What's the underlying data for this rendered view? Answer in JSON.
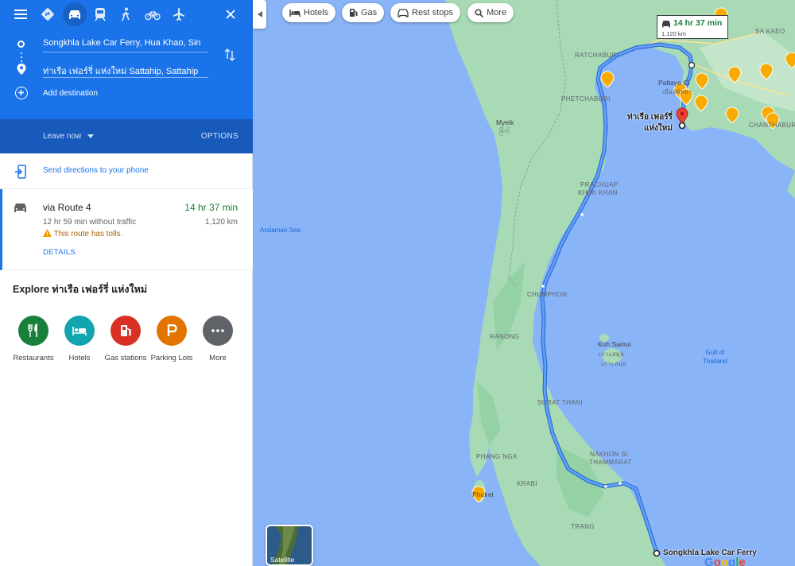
{
  "modes": [
    {
      "name": "menu-icon"
    },
    {
      "name": "best-route-icon"
    },
    {
      "name": "driving-icon",
      "active": true
    },
    {
      "name": "transit-icon"
    },
    {
      "name": "walking-icon"
    },
    {
      "name": "cycling-icon"
    },
    {
      "name": "flight-icon"
    },
    {
      "name": "close-icon"
    }
  ],
  "directions": {
    "origin": "Songkhla Lake Car Ferry, Hua Khao, Sin",
    "destination": "ท่าเรือ เฟอร์รี่ แห่งใหม่ Sattahip, Sattahip",
    "add_destination": "Add destination",
    "leave": "Leave now",
    "options": "OPTIONS",
    "send": "Send directions to your phone"
  },
  "route": {
    "title": "via Route 4",
    "time": "14 hr 37 min",
    "without_traffic": "12 hr 59 min without traffic",
    "distance": "1,120 km",
    "toll": "This route has tolls.",
    "details": "DETAILS"
  },
  "explore": {
    "title": "Explore ท่าเรือ เฟอร์รี่ แห่งใหม่",
    "categories": [
      {
        "label": "Restaurants",
        "color": "#188038",
        "icon": "restaurant-icon"
      },
      {
        "label": "Hotels",
        "color": "#12a4af",
        "icon": "hotel-icon"
      },
      {
        "label": "Gas stations",
        "color": "#d93025",
        "icon": "gas-station-icon"
      },
      {
        "label": "Parking Lots",
        "color": "#e37400",
        "icon": "parking-icon"
      },
      {
        "label": "More",
        "color": "#5f6368",
        "icon": "more-icon"
      }
    ]
  },
  "map": {
    "chips": [
      "Hotels",
      "Gas",
      "Rest stops",
      "More"
    ],
    "infobox_time": "14 hr 37 min",
    "infobox_distance": "1,120 km",
    "destination_label_1": "ท่าเรือ เฟอร์รี่",
    "destination_label_2": "แห่งใหม่",
    "origin_label": "Songkhla Lake Car Ferry",
    "satellite": "Satellite",
    "labels": {
      "ratchaburi": "RATCHABURI",
      "phetchaburi": "PHETCHABURI",
      "myeik": "Myeik",
      "myeik_local": "မြိတ်",
      "prachuap1": "PRACHUAP",
      "prachuap2": "KHIRI KHAN",
      "chumphon": "CHUMPHON",
      "ranong": "RANONG",
      "surat": "SURAT THANI",
      "phangnga": "PHANG NGA",
      "krabi": "KRABI",
      "nakhon1": "NAKHON SI",
      "nakhon2": "THAMMARAT",
      "trang": "TRANG",
      "chanthaburi": "CHANTHABURI",
      "sakaeo": "SA KAEO",
      "pattaya": "Pattaya Ci",
      "pattaya_local": "เมืองพัทยา",
      "andaman": "Andaman Sea",
      "koh_samui": "Koh Samui",
      "koh_samui_local1": "เกาะสมุย",
      "koh_samui_local2": "เกาะสมุย",
      "gulf1": "Gulf of",
      "gulf2": "Thailand",
      "phuket": "Phuket"
    },
    "google": "Google"
  },
  "colors": {
    "accent": "#1a73e8",
    "route": "#4285f4",
    "land": "#a8dab5",
    "water": "#8ab4f8",
    "traffic_green": "#188038"
  }
}
